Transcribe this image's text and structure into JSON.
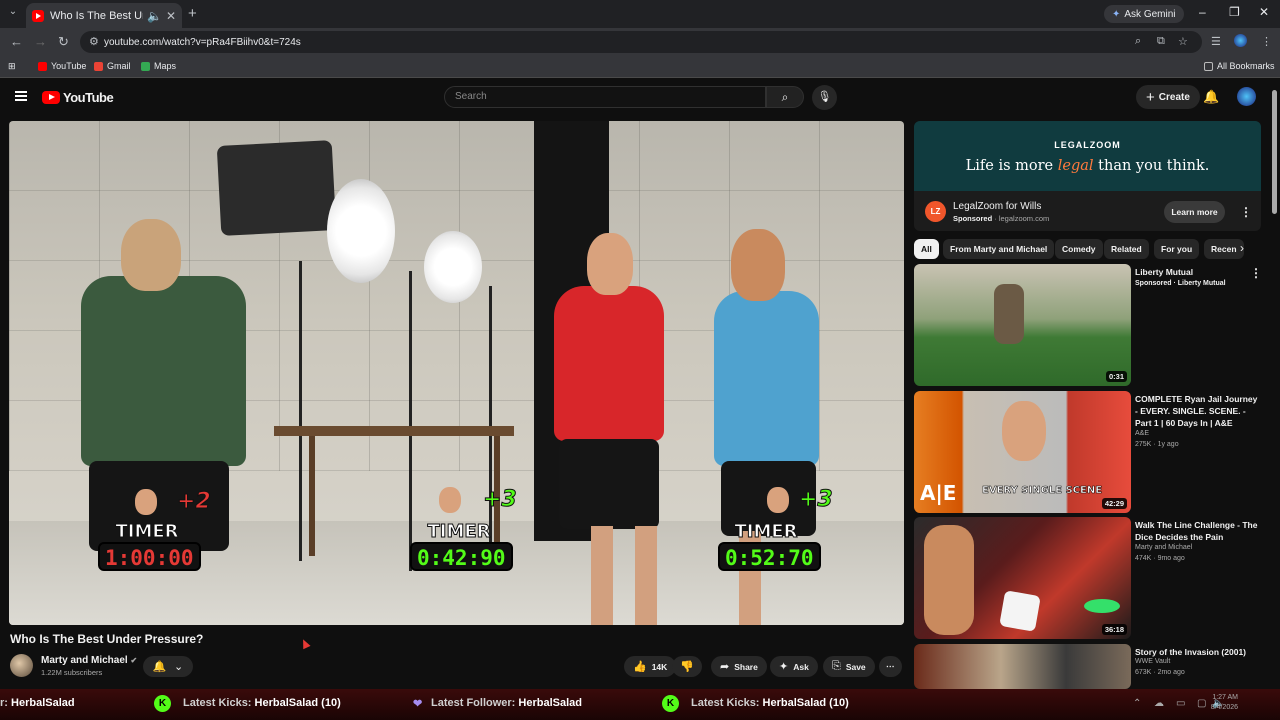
{
  "browser": {
    "tab_title": "Who Is The Best Under Pre",
    "url": "youtube.com/watch?v=pRa4FBiihv0&t=724s",
    "ask_gemini": "Ask Gemini",
    "bookmarks": [
      "YouTube",
      "Gmail",
      "Maps"
    ],
    "all_bookmarks": "All Bookmarks"
  },
  "header": {
    "logo": "YouTube",
    "search_placeholder": "Search",
    "create": "Create"
  },
  "video": {
    "title": "Who Is The Best Under Pressure?",
    "players": [
      {
        "points": "+2",
        "label": "TIMER",
        "time": "1:00:00",
        "color": "#e53935"
      },
      {
        "points": "+3",
        "label": "TIMER",
        "time": "0:42:90",
        "color": "#53fc18"
      },
      {
        "points": "+3",
        "label": "TIMER",
        "time": "0:52:70",
        "color": "#53fc18"
      }
    ]
  },
  "channel": {
    "name": "Marty and Michael",
    "subscribers": "1.22M subscribers"
  },
  "actions": {
    "likes": "14K",
    "share": "Share",
    "ask": "Ask",
    "save": "Save"
  },
  "ad": {
    "brand": "LEGALZOOM",
    "tagline_pre": "Life is more ",
    "tagline_em": "legal",
    "tagline_post": " than you think.",
    "logo_text": "LZ",
    "name": "LegalZoom for Wills",
    "sponsored": "Sponsored",
    "domain": "legalzoom.com",
    "cta": "Learn more"
  },
  "chips": [
    "All",
    "From Marty and Michael",
    "Comedy",
    "Related",
    "For you",
    "Recen"
  ],
  "recommendations": [
    {
      "title": "Liberty Mutual",
      "channel": "Sponsored · Liberty Mutual",
      "meta": "",
      "duration": "0:31"
    },
    {
      "title": "COMPLETE Ryan Jail Journey - EVERY. SINGLE. SCENE. - Part 1 | 60 Days In | A&E",
      "channel": "A&E",
      "meta": "275K · 1y ago",
      "duration": "42:29",
      "thumb_text": "EVERY SINGLE SCENE"
    },
    {
      "title": "Walk The Line Challenge - The Dice Decides the Pain",
      "channel": "Marty and Michael",
      "meta": "474K · 9mo ago",
      "duration": "36:18"
    },
    {
      "title": "Story of the Invasion (2001)",
      "channel": "WWE Vault",
      "meta": "673K · 2mo ago",
      "duration": ""
    }
  ],
  "taskbar": {
    "ticker": [
      {
        "prefix": "r:",
        "name": "HerbalSalad"
      },
      {
        "prefix": "Latest Kicks:",
        "name": "HerbalSalad (10)"
      },
      {
        "prefix": "Latest Follower:",
        "name": "HerbalSalad"
      },
      {
        "prefix": "Latest Kicks:",
        "name": "HerbalSalad (10)"
      }
    ],
    "time": "1:27 AM",
    "date": "8/4/2026"
  }
}
